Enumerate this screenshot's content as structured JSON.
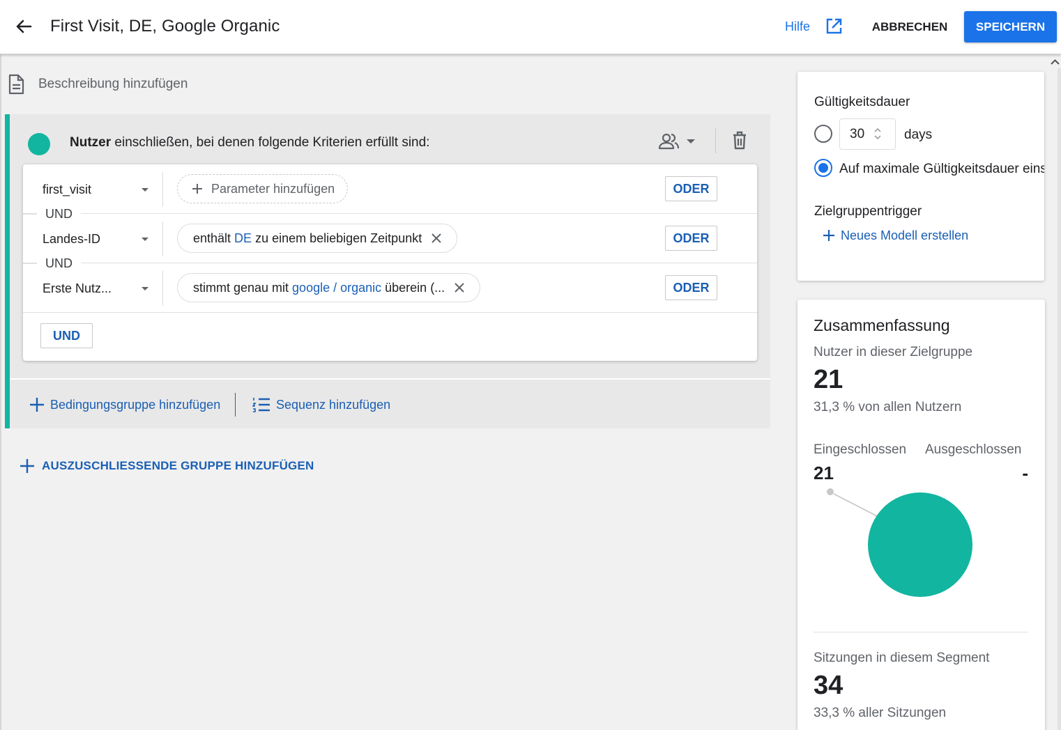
{
  "header": {
    "title": "First Visit, DE, Google Organic",
    "help_label": "Hilfe",
    "cancel_label": "ABBRECHEN",
    "save_label": "SPEICHERN"
  },
  "description": {
    "placeholder": "Beschreibung hinzufügen"
  },
  "condition_group": {
    "scope_bold": "Nutzer",
    "scope_text": " einschließen, bei denen folgende Kriterien erfüllt sind:",
    "rows": [
      {
        "dimension": "first_visit",
        "chip": {
          "prefix": "Parameter hinzufügen"
        },
        "or_label": "ODER"
      },
      {
        "dimension": "Landes-ID",
        "chip": {
          "prefix": "enthält ",
          "value": "DE",
          "suffix": " zu einem beliebigen Zeitpunkt"
        },
        "or_label": "ODER"
      },
      {
        "dimension": "Erste Nutz...",
        "chip": {
          "prefix": "stimmt genau mit ",
          "value": "google / organic",
          "suffix": " überein (..."
        },
        "or_label": "ODER"
      }
    ],
    "and_separator": "UND",
    "and_button": "UND",
    "add_condition_group": "Bedingungsgruppe hinzufügen",
    "add_sequence": "Sequenz hinzufügen"
  },
  "add_exclude_group": "AUSZUSCHLIESSENDE GRUPPE HINZUFÜGEN",
  "validity": {
    "title": "Gültigkeitsdauer",
    "days_value": "30",
    "days_unit": "days",
    "max_option": "Auf maximale Gültigkeitsdauer einstellen",
    "selected_option": "max",
    "trigger_title": "Zielgruppentrigger",
    "new_model": "Neues Modell erstellen"
  },
  "summary": {
    "title": "Zusammenfassung",
    "users_label": "Nutzer in dieser Zielgruppe",
    "users_value": "21",
    "users_pct": "31,3 % von allen Nutzern",
    "included_label": "Eingeschlossen",
    "excluded_label": "Ausgeschlossen",
    "included_value": "21",
    "excluded_value": "-",
    "sessions_label": "Sitzungen in diesem Segment",
    "sessions_value": "34",
    "sessions_pct": "33,3 % aller Sitzungen"
  },
  "colors": {
    "accent": "#1a73e8",
    "link": "#1a5fb4",
    "group": "#12b5a0"
  }
}
